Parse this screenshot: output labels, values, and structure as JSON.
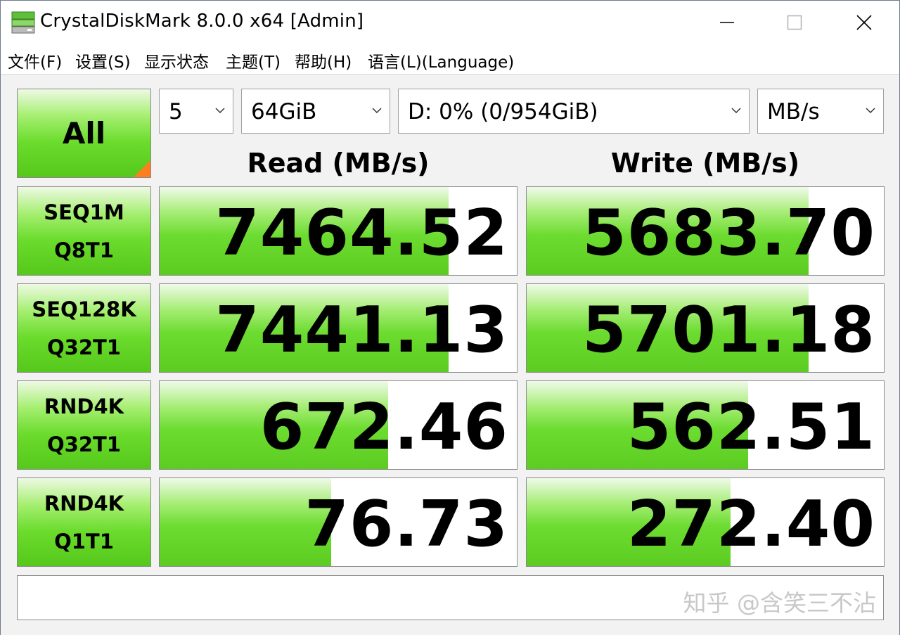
{
  "window": {
    "title": "CrystalDiskMark 8.0.0 x64 [Admin]",
    "icon": "disk-drive-icon"
  },
  "menu": [
    {
      "label": "文件(F)"
    },
    {
      "label": "设置(S)"
    },
    {
      "label": "显示状态"
    },
    {
      "label": "主题(T)"
    },
    {
      "label": "帮助(H)"
    },
    {
      "label": "语言(L)(Language)"
    }
  ],
  "controls": {
    "all_label": "All",
    "count": "5",
    "size": "64GiB",
    "drive": "D: 0% (0/954GiB)",
    "unit": "MB/s"
  },
  "headers": {
    "read": "Read (MB/s)",
    "write": "Write (MB/s)"
  },
  "tests": [
    {
      "line1": "SEQ1M",
      "line2": "Q8T1",
      "read": "7464.52",
      "write": "5683.70",
      "read_fill": 0.81,
      "write_fill": 0.79
    },
    {
      "line1": "SEQ128K",
      "line2": "Q32T1",
      "read": "7441.13",
      "write": "5701.18",
      "read_fill": 0.81,
      "write_fill": 0.79
    },
    {
      "line1": "RND4K",
      "line2": "Q32T1",
      "read": "672.46",
      "write": "562.51",
      "read_fill": 0.64,
      "write_fill": 0.62
    },
    {
      "line1": "RND4K",
      "line2": "Q1T1",
      "read": "76.73",
      "write": "272.40",
      "read_fill": 0.48,
      "write_fill": 0.57
    }
  ],
  "comment": "",
  "watermark": "知乎 @含笑三不沾",
  "colors": {
    "accent_green": "#6cdc30",
    "corner_orange": "#ff7f1f"
  }
}
